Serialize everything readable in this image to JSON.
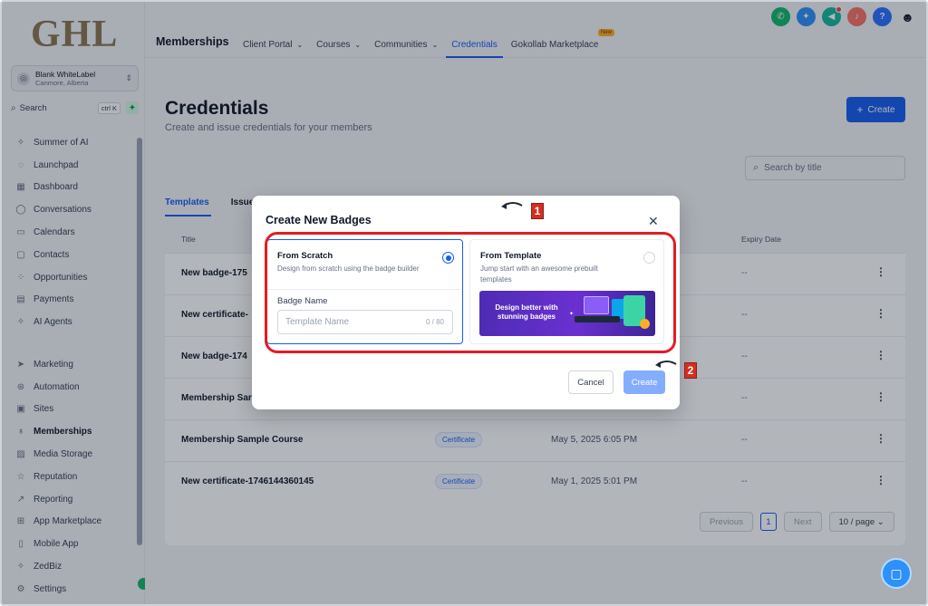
{
  "sidebar": {
    "logo": "GHL",
    "account": {
      "name": "Blank WhiteLabel",
      "location": "Canmore, Alberta"
    },
    "search": {
      "label": "Search",
      "shortcut": "ctrl K"
    },
    "items_top": [
      {
        "label": "Summer of AI",
        "icon": "sparkle-icon"
      },
      {
        "label": "Launchpad",
        "icon": "rocket-icon"
      },
      {
        "label": "Dashboard",
        "icon": "dashboard-icon"
      },
      {
        "label": "Conversations",
        "icon": "chat-icon"
      },
      {
        "label": "Calendars",
        "icon": "calendar-icon"
      },
      {
        "label": "Contacts",
        "icon": "contacts-icon"
      },
      {
        "label": "Opportunities",
        "icon": "opportunities-icon"
      },
      {
        "label": "Payments",
        "icon": "payments-icon"
      },
      {
        "label": "AI Agents",
        "icon": "sparkle-icon"
      }
    ],
    "items_bottom": [
      {
        "label": "Marketing",
        "icon": "send-icon"
      },
      {
        "label": "Automation",
        "icon": "automation-icon"
      },
      {
        "label": "Sites",
        "icon": "sites-icon"
      },
      {
        "label": "Memberships",
        "icon": "membership-icon",
        "active": true
      },
      {
        "label": "Media Storage",
        "icon": "image-icon"
      },
      {
        "label": "Reputation",
        "icon": "star-icon"
      },
      {
        "label": "Reporting",
        "icon": "chart-icon"
      },
      {
        "label": "App Marketplace",
        "icon": "grid-icon"
      },
      {
        "label": "Mobile App",
        "icon": "mobile-icon"
      },
      {
        "label": "ZedBiz",
        "icon": "sparkle-icon"
      },
      {
        "label": "Settings",
        "icon": "gear-icon"
      }
    ]
  },
  "header": {
    "section": "Memberships",
    "tabs": [
      {
        "label": "Client Portal",
        "dropdown": true
      },
      {
        "label": "Courses",
        "dropdown": true
      },
      {
        "label": "Communities",
        "dropdown": true
      },
      {
        "label": "Credentials",
        "dropdown": false,
        "active": true
      },
      {
        "label": "Gokollab Marketplace",
        "dropdown": false
      }
    ],
    "new_badge": "New"
  },
  "page": {
    "title": "Credentials",
    "subtitle": "Create and issue credentials for your members",
    "create_label": "Create",
    "search_placeholder": "Search by title",
    "tabs": [
      "Templates",
      "Issue"
    ]
  },
  "table": {
    "headers": {
      "title": "Title",
      "expiry": "Expiry Date"
    },
    "rows": [
      {
        "title": "New badge-175",
        "type": "",
        "date": "",
        "expiry": "--"
      },
      {
        "title": "New certificate-",
        "type": "",
        "date": "",
        "expiry": "--"
      },
      {
        "title": "New badge-174",
        "type": "",
        "date": "",
        "expiry": "--"
      },
      {
        "title": "Membership Sar",
        "type": "",
        "date": "",
        "expiry": "--"
      },
      {
        "title": "Membership Sample Course",
        "type": "Certificate",
        "date": "May 5, 2025 6:05 PM",
        "expiry": "--"
      },
      {
        "title": "New certificate-1746144360145",
        "type": "Certificate",
        "date": "May 1, 2025 5:01 PM",
        "expiry": "--"
      }
    ],
    "pagination": {
      "prev": "Previous",
      "page": "1",
      "next": "Next",
      "page_size": "10 / page"
    }
  },
  "modal": {
    "title": "Create New Badges",
    "scratch": {
      "title": "From Scratch",
      "desc": "Design from scratch using the badge builder",
      "selected": true,
      "field_label": "Badge Name",
      "placeholder": "Template Name",
      "counter": "0 / 80"
    },
    "template": {
      "title": "From Template",
      "desc": "Jump start with an awesome prebuilt templates",
      "selected": false,
      "banner_text": "Design better with stunning badges"
    },
    "cancel_label": "Cancel",
    "create_label": "Create"
  },
  "annotations": [
    "1",
    "2"
  ],
  "colors": {
    "accent": "#155eef",
    "highlight": "#e31b23"
  }
}
